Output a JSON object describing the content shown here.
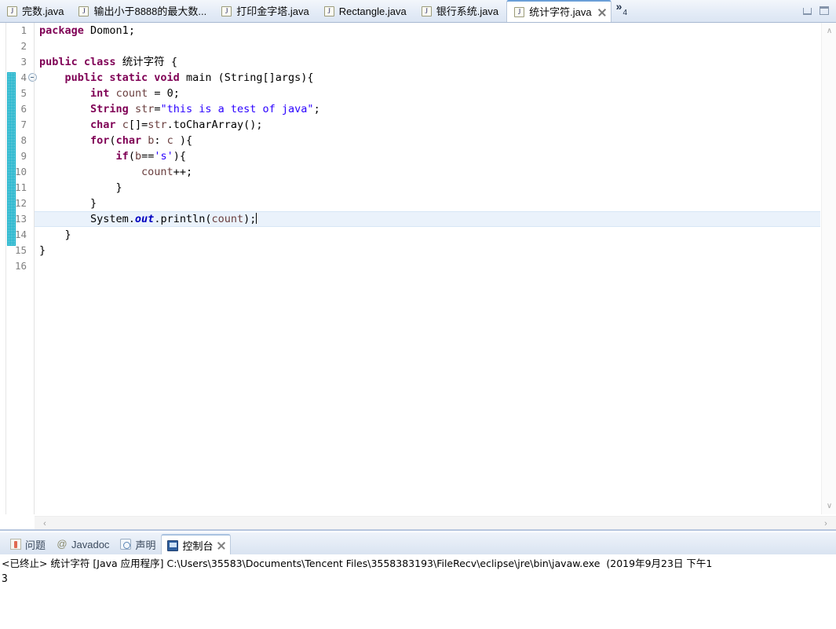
{
  "window": {
    "minimize_label": "Minimize",
    "maximize_label": "Maximize"
  },
  "editor_tabs": {
    "overflow_chevron": "»",
    "overflow_count": "4",
    "items": [
      {
        "label": "完数.java",
        "icon": "java-file-icon",
        "active": false,
        "closable": false
      },
      {
        "label": "输出小于8888的最大数...",
        "icon": "java-file-icon",
        "active": false,
        "closable": false
      },
      {
        "label": "打印金字塔.java",
        "icon": "java-file-icon",
        "active": false,
        "closable": false
      },
      {
        "label": "Rectangle.java",
        "icon": "java-file-icon",
        "active": false,
        "closable": false
      },
      {
        "label": "银行系统.java",
        "icon": "java-file-icon",
        "active": false,
        "closable": false
      },
      {
        "label": "统计字符.java",
        "icon": "java-file-icon",
        "active": true,
        "closable": true
      }
    ]
  },
  "editor": {
    "line_numbers": [
      "1",
      "2",
      "3",
      "4",
      "5",
      "6",
      "7",
      "8",
      "9",
      "10",
      "11",
      "12",
      "13",
      "14",
      "15",
      "16"
    ],
    "current_line": 13,
    "fold_marker_line": 4,
    "scroll_up_glyph": "∧",
    "scroll_down_glyph": "∨",
    "hscroll_left_glyph": "‹",
    "hscroll_right_glyph": "›",
    "code_lines": [
      {
        "n": 1,
        "text": "package Domon1;"
      },
      {
        "n": 2,
        "text": ""
      },
      {
        "n": 3,
        "text": "public class 统计字符 {"
      },
      {
        "n": 4,
        "text": "    public static void main (String[]args){"
      },
      {
        "n": 5,
        "text": "        int count = 0;"
      },
      {
        "n": 6,
        "text": "        String str=\"this is a test of java\";"
      },
      {
        "n": 7,
        "text": "        char c[]=str.toCharArray();"
      },
      {
        "n": 8,
        "text": "        for(char b: c ){"
      },
      {
        "n": 9,
        "text": "            if(b=='s'){"
      },
      {
        "n": 10,
        "text": "                count++;"
      },
      {
        "n": 11,
        "text": "            }"
      },
      {
        "n": 12,
        "text": "        }"
      },
      {
        "n": 13,
        "text": "        System.out.println(count);"
      },
      {
        "n": 14,
        "text": "    }"
      },
      {
        "n": 15,
        "text": "}"
      },
      {
        "n": 16,
        "text": ""
      }
    ]
  },
  "console_tabs": {
    "items": [
      {
        "label": "问题",
        "icon": "problems-icon",
        "active": false,
        "closable": false
      },
      {
        "label": "Javadoc",
        "icon": "javadoc-icon",
        "active": false,
        "closable": false
      },
      {
        "label": "声明",
        "icon": "declaration-icon",
        "active": false,
        "closable": false
      },
      {
        "label": "控制台",
        "icon": "console-icon",
        "active": true,
        "closable": true
      }
    ]
  },
  "console": {
    "header": "<已终止> 统计字符 [Java 应用程序] C:\\Users\\35583\\Documents\\Tencent Files\\3558383193\\FileRecv\\eclipse\\jre\\bin\\javaw.exe  (2019年9月23日 下午1",
    "output": "3"
  },
  "colors": {
    "keyword": "#7f0055",
    "string": "#2a00ff",
    "static_field": "#0000c0",
    "local_var": "#6a3e3e",
    "current_line_highlight": "#eaf2fb",
    "range_bar": "#00a9c5",
    "active_tab_border": "#6a9fd8"
  }
}
